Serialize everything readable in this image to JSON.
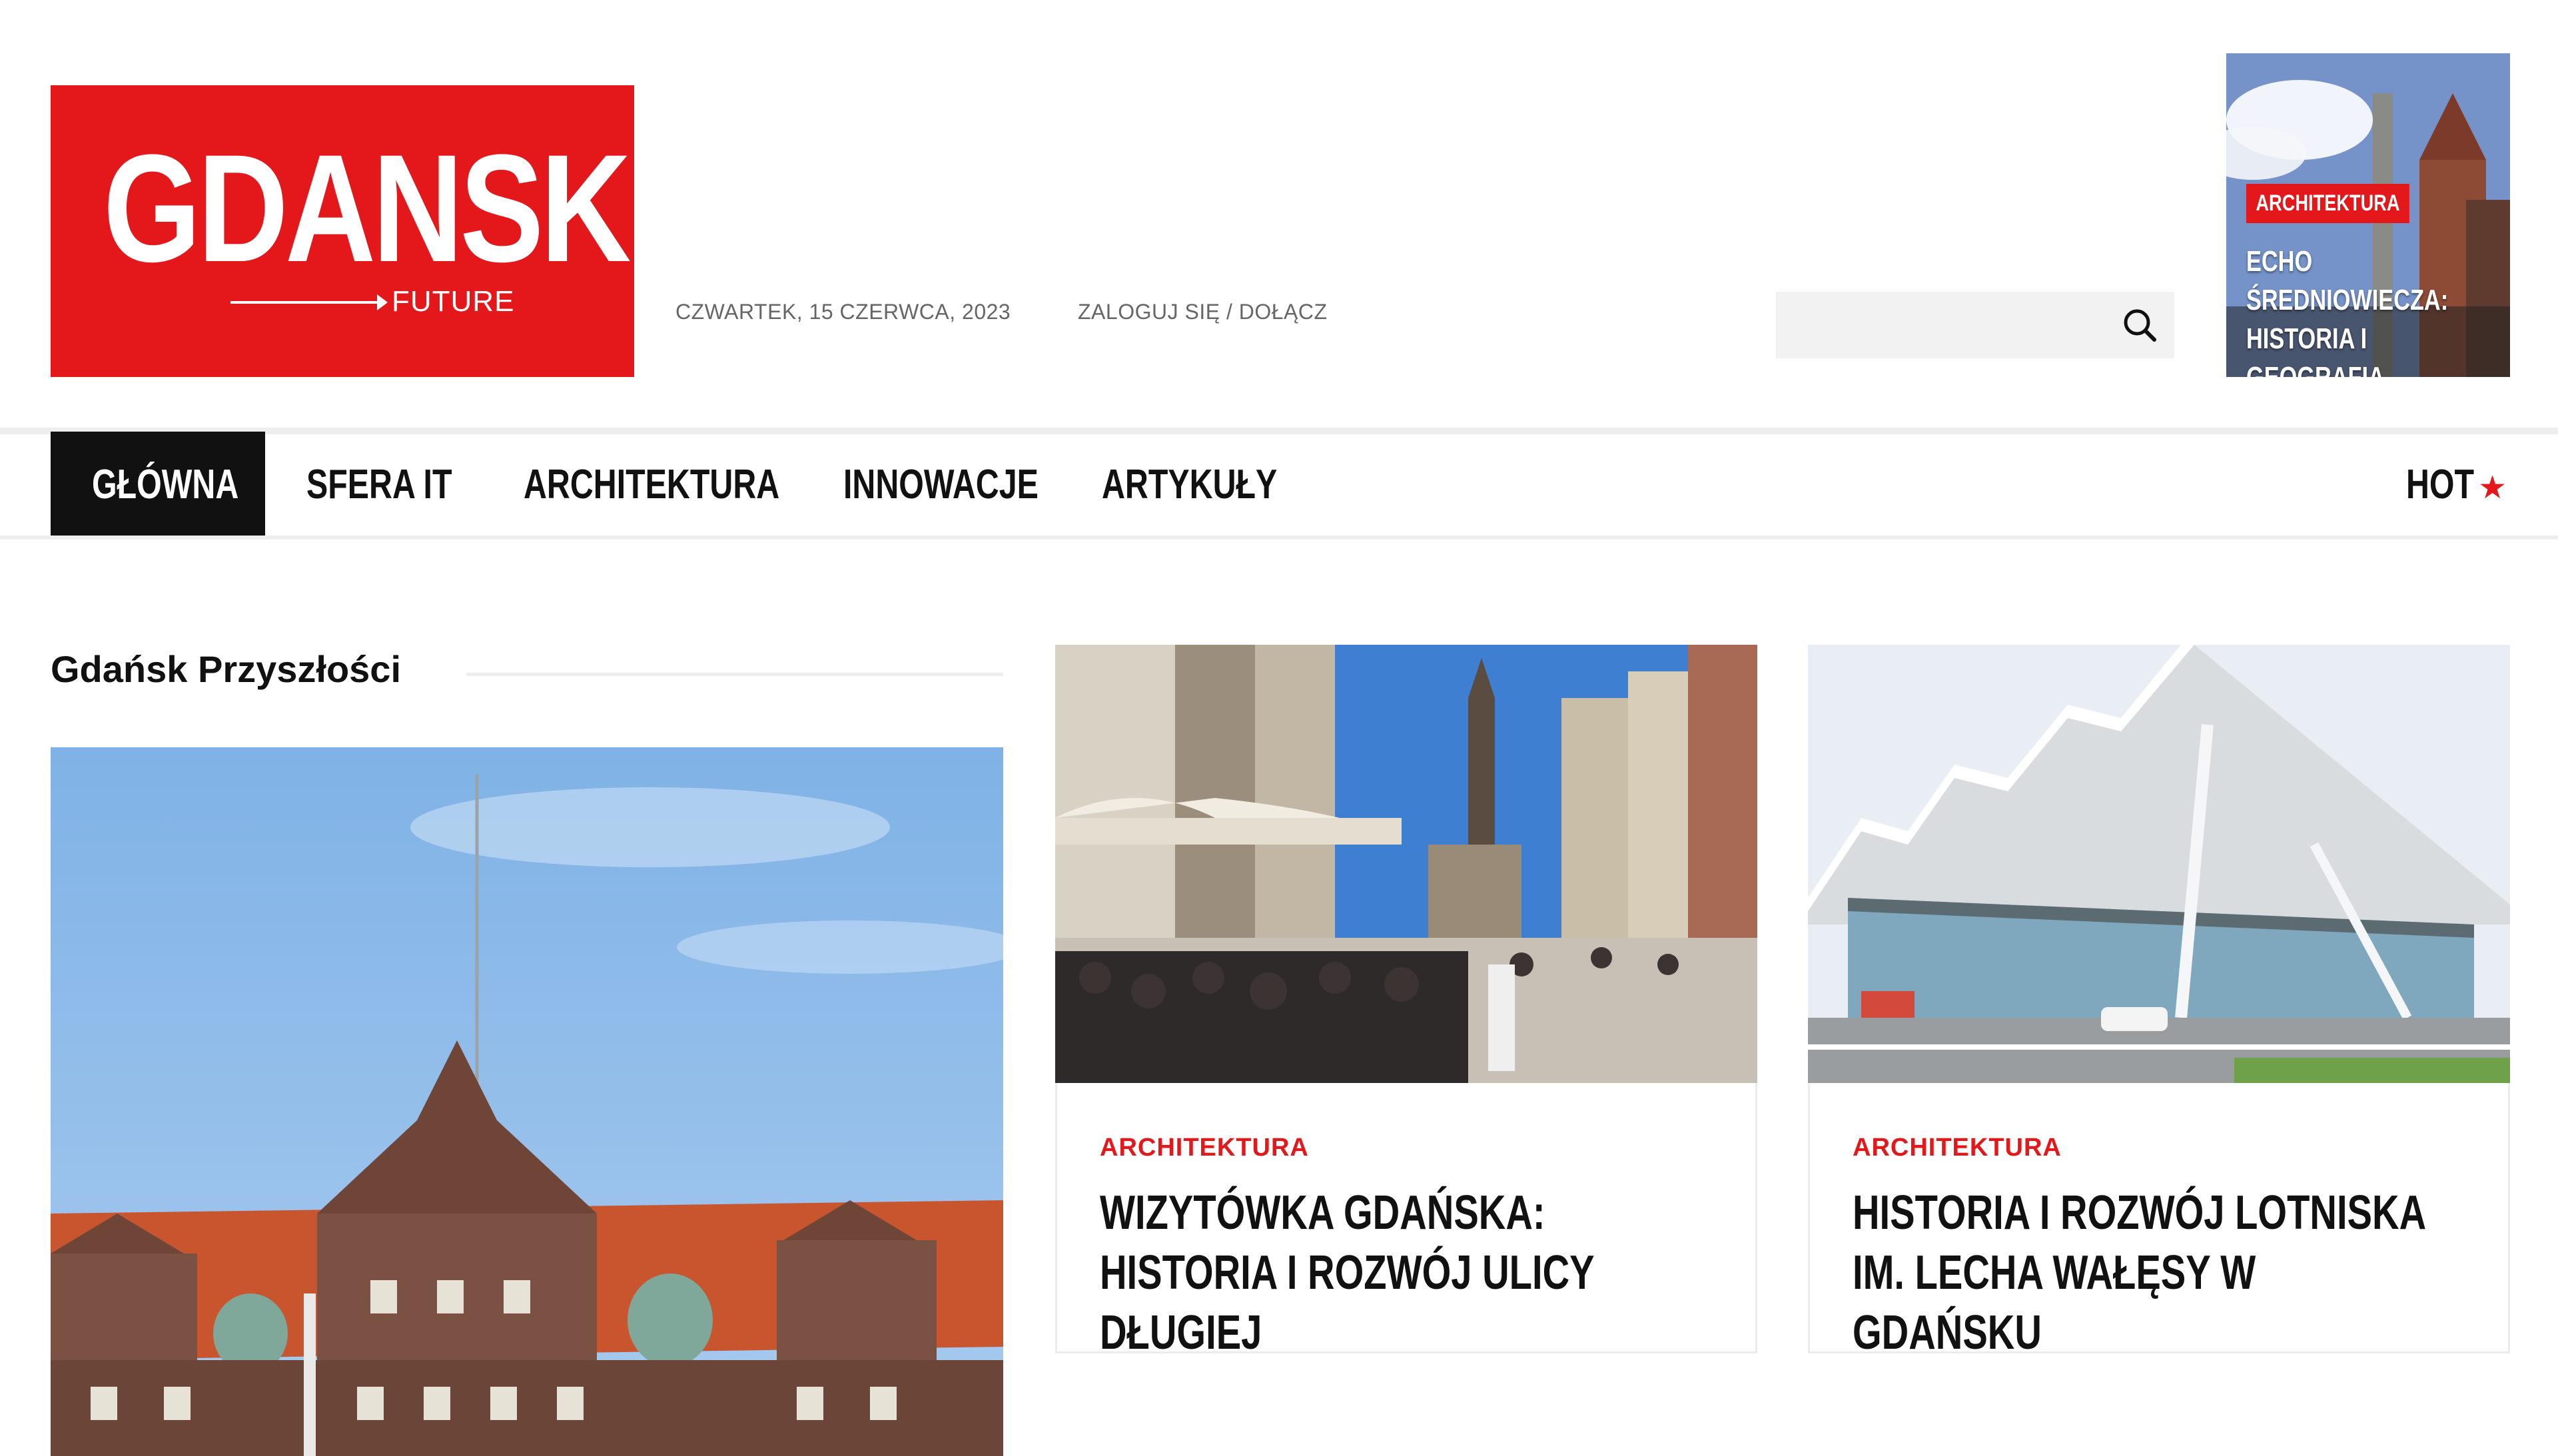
{
  "brand": {
    "logo_text": "GDANSK",
    "logo_sub": "FUTURE",
    "color": "#e4171b"
  },
  "header": {
    "date": "CZWARTEK, 15 CZERWCA, 2023",
    "login": "ZALOGUJ SIĘ / DOŁĄCZ",
    "search_placeholder": ""
  },
  "promo": {
    "category": "ARCHITEKTURA",
    "title": "ECHO ŚREDNIOWIECZA: HISTORIA I GEOGRAFIA DZIELNICY SIEDLCE"
  },
  "nav": {
    "items": [
      {
        "label": "GŁÓWNA",
        "active": true
      },
      {
        "label": "SFERA IT"
      },
      {
        "label": "ARCHITEKTURA"
      },
      {
        "label": "INNOWACJE"
      },
      {
        "label": "ARTYKUŁY"
      }
    ],
    "hot": "HOT"
  },
  "section": {
    "title": "Gdańsk Przyszłości"
  },
  "cards": [
    {
      "category": "ARCHITEKTURA",
      "title": "WIZYTÓWKA GDAŃSKA: HISTORIA I ROZWÓJ ULICY DŁUGIEJ"
    },
    {
      "category": "ARCHITEKTURA",
      "title": "HISTORIA I ROZWÓJ LOTNISKA IM. LECHA WAŁĘSY W GDAŃSKU"
    }
  ]
}
